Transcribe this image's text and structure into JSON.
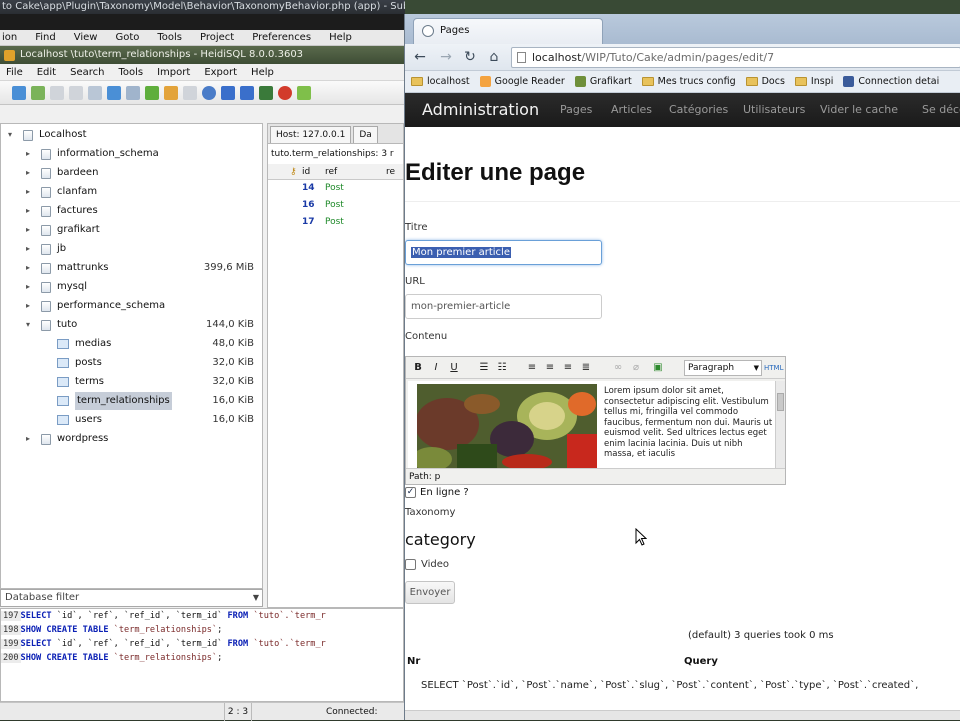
{
  "sublime": {
    "title": "to Cake\\app\\Plugin\\Taxonomy\\Model\\Behavior\\TaxonomyBehavior.php (app) - Sublime",
    "menu": [
      "ion",
      "Find",
      "View",
      "Goto",
      "Tools",
      "Project",
      "Preferences",
      "Help"
    ]
  },
  "heidi": {
    "title": "Localhost \\tuto\\term_relationships - HeidiSQL 8.0.0.3603",
    "menu": [
      "File",
      "Edit",
      "Search",
      "Tools",
      "Import",
      "Export",
      "Help"
    ],
    "tree": [
      {
        "label": "Localhost",
        "size": "",
        "level": 0,
        "expander": "▾",
        "icon": "server"
      },
      {
        "label": "information_schema",
        "size": "",
        "level": 1,
        "expander": "▸",
        "icon": "db"
      },
      {
        "label": "bardeen",
        "size": "",
        "level": 1,
        "expander": "▸",
        "icon": "db"
      },
      {
        "label": "clanfam",
        "size": "",
        "level": 1,
        "expander": "▸",
        "icon": "db"
      },
      {
        "label": "factures",
        "size": "",
        "level": 1,
        "expander": "▸",
        "icon": "db"
      },
      {
        "label": "grafikart",
        "size": "",
        "level": 1,
        "expander": "▸",
        "icon": "db"
      },
      {
        "label": "jb",
        "size": "",
        "level": 1,
        "expander": "▸",
        "icon": "db"
      },
      {
        "label": "mattrunks",
        "size": "399,6 MiB",
        "level": 1,
        "expander": "▸",
        "icon": "db"
      },
      {
        "label": "mysql",
        "size": "",
        "level": 1,
        "expander": "▸",
        "icon": "db"
      },
      {
        "label": "performance_schema",
        "size": "",
        "level": 1,
        "expander": "▸",
        "icon": "db"
      },
      {
        "label": "tuto",
        "size": "144,0 KiB",
        "level": 1,
        "expander": "▾",
        "icon": "db"
      },
      {
        "label": "medias",
        "size": "48,0 KiB",
        "level": 2,
        "expander": "",
        "icon": "table"
      },
      {
        "label": "posts",
        "size": "32,0 KiB",
        "level": 2,
        "expander": "",
        "icon": "table"
      },
      {
        "label": "terms",
        "size": "32,0 KiB",
        "level": 2,
        "expander": "",
        "icon": "table"
      },
      {
        "label": "term_relationships",
        "size": "16,0 KiB",
        "level": 2,
        "expander": "",
        "icon": "table",
        "selected": true
      },
      {
        "label": "users",
        "size": "16,0 KiB",
        "level": 2,
        "expander": "",
        "icon": "table"
      },
      {
        "label": "wordpress",
        "size": "",
        "level": 1,
        "expander": "▸",
        "icon": "db"
      }
    ],
    "db_filter_placeholder": "Database filter",
    "host_tabs": [
      "Host: 127.0.0.1",
      "Da"
    ],
    "table_caption": "tuto.term_relationships: 3 r",
    "grid_columns": [
      "id",
      "ref",
      "re"
    ],
    "grid_rows": [
      {
        "id": "14",
        "ref": "Post"
      },
      {
        "id": "16",
        "ref": "Post"
      },
      {
        "id": "17",
        "ref": "Post"
      }
    ],
    "sql_log": [
      {
        "num": "197",
        "parts": [
          [
            "kw",
            "SELECT"
          ],
          [
            "txt",
            " `id`, `ref`, `ref_id`, `term_id` "
          ],
          [
            "kw",
            "FROM"
          ],
          [
            "str",
            " `tuto`.`term_r"
          ]
        ]
      },
      {
        "num": "198",
        "parts": [
          [
            "kw",
            "SHOW CREATE TABLE"
          ],
          [
            "str",
            " `term_relationships`"
          ],
          [
            "txt",
            ";"
          ]
        ]
      },
      {
        "num": "199",
        "parts": [
          [
            "kw",
            "SELECT"
          ],
          [
            "txt",
            " `id`, `ref`, `ref_id`, `term_id` "
          ],
          [
            "kw",
            "FROM"
          ],
          [
            "str",
            " `tuto`.`term_r"
          ]
        ]
      },
      {
        "num": "200",
        "parts": [
          [
            "kw",
            "SHOW CREATE TABLE"
          ],
          [
            "str",
            " `term_relationships`"
          ],
          [
            "txt",
            ";"
          ]
        ]
      }
    ],
    "status_position": "2 : 3",
    "status_connection": "Connected:"
  },
  "chrome": {
    "tab_title": "Pages",
    "url_host": "localhost",
    "url_path": "/WIP/Tuto/Cake/admin/pages/edit/7",
    "bookmarks": [
      {
        "label": "localhost",
        "type": "folder"
      },
      {
        "label": "Google Reader",
        "type": "site",
        "color": "#f4a340"
      },
      {
        "label": "Grafikart",
        "type": "site",
        "color": "#6f8f3a"
      },
      {
        "label": "Mes trucs config",
        "type": "folder"
      },
      {
        "label": "Docs",
        "type": "folder"
      },
      {
        "label": "Inspi",
        "type": "folder"
      },
      {
        "label": "Connection detai",
        "type": "site",
        "color": "#3b5b9a"
      }
    ]
  },
  "admin": {
    "brand": "Administration",
    "nav": [
      "Pages",
      "Articles",
      "Catégories",
      "Utilisateurs",
      "Vider le cache",
      "Se déco"
    ],
    "heading": "Editer une page",
    "fields": {
      "title_label": "Titre",
      "title_value": "Mon premier article",
      "url_label": "URL",
      "url_value": "mon-premier-article",
      "content_label": "Contenu"
    },
    "editor": {
      "format": "Paragraph",
      "text": "Lorem ipsum dolor sit amet, consectetur adipiscing elit. Vestibulum tellus mi, fringilla vel commodo faucibus, fermentum non dui. Mauris ut euismod velit. Sed ultrices lectus eget enim lacinia lacinia. Duis ut nibh massa, et iaculis",
      "path": "Path: p"
    },
    "online_label": "En ligne ?",
    "taxonomy_label": "Taxonomy",
    "category_heading": "category",
    "video_label": "Video",
    "submit_label": "Envoyer",
    "query_summary": "(default) 3 queries took 0 ms",
    "query_col_nr": "Nr",
    "query_col_query": "Query",
    "query_row": "SELECT `Post`.`id`, `Post`.`name`, `Post`.`slug`, `Post`.`content`, `Post`.`type`, `Post`.`created`,"
  },
  "colors": {
    "admin_nav_bg": "#1a1a1a",
    "selection_bg": "#3b5fb0",
    "sql_keyword": "#0b20b5",
    "grid_id": "#1a3aa6",
    "grid_ref": "#1f8a2a"
  }
}
